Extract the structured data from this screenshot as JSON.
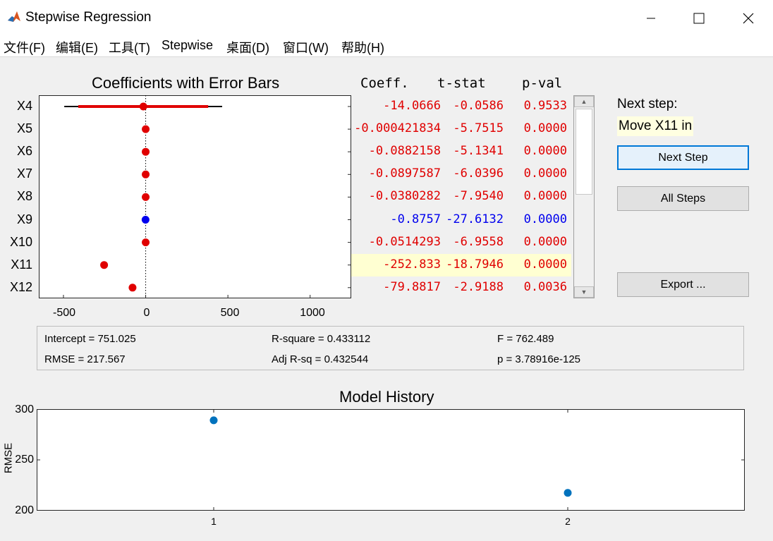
{
  "window": {
    "title": "Stepwise Regression"
  },
  "menu": [
    {
      "label": "文件(F)"
    },
    {
      "label": "编辑(E)"
    },
    {
      "label": "工具(T)"
    },
    {
      "label": "Stepwise"
    },
    {
      "label": "桌面(D)"
    },
    {
      "label": "窗口(W)"
    },
    {
      "label": "帮助(H)"
    }
  ],
  "coef_plot": {
    "title": "Coefficients with Error Bars",
    "x_ticks": [
      "-500",
      "0",
      "500",
      "1000"
    ]
  },
  "table": {
    "headers": {
      "coeff": "Coeff.",
      "tstat": "t-stat",
      "pval": "p-val"
    },
    "rows": [
      {
        "name": "X4",
        "coeff": "-14.0666",
        "tstat": "-0.0586",
        "pval": "0.9533",
        "in_model": true
      },
      {
        "name": "X5",
        "coeff": "-0.000421834",
        "tstat": "-5.7515",
        "pval": "0.0000",
        "in_model": true
      },
      {
        "name": "X6",
        "coeff": "-0.0882158",
        "tstat": "-5.1341",
        "pval": "0.0000",
        "in_model": true
      },
      {
        "name": "X7",
        "coeff": "-0.0897587",
        "tstat": "-6.0396",
        "pval": "0.0000",
        "in_model": true
      },
      {
        "name": "X8",
        "coeff": "-0.0380282",
        "tstat": "-7.9540",
        "pval": "0.0000",
        "in_model": true
      },
      {
        "name": "X9",
        "coeff": "-0.8757",
        "tstat": "-27.6132",
        "pval": "0.0000",
        "in_model": false
      },
      {
        "name": "X10",
        "coeff": "-0.0514293",
        "tstat": "-6.9558",
        "pval": "0.0000",
        "in_model": true
      },
      {
        "name": "X11",
        "coeff": "-252.833",
        "tstat": "-18.7946",
        "pval": "0.0000",
        "in_model": true,
        "highlight": true
      },
      {
        "name": "X12",
        "coeff": "-79.8817",
        "tstat": "-2.9188",
        "pval": "0.0036",
        "in_model": true
      }
    ]
  },
  "side": {
    "next_step_label": "Next step:",
    "next_step_value": "Move X11 in",
    "next_step_button": "Next Step",
    "all_steps_button": "All Steps",
    "export_button": "Export ..."
  },
  "stats": {
    "intercept": "Intercept = 751.025",
    "rmse": "RMSE = 217.567",
    "rsq": "R-square = 0.433112",
    "adjrsq": "Adj R-sq = 0.432544",
    "f": "F = 762.489",
    "p": "p = 3.78916e-125"
  },
  "history": {
    "title": "Model History",
    "ylabel": "RMSE",
    "y_ticks": [
      "300",
      "250",
      "200"
    ],
    "x_ticks": [
      "1",
      "2"
    ]
  },
  "colors": {
    "in_model": "#e00000",
    "out_model": "#0000ee",
    "history_point": "#0072bd",
    "highlight": "#ffffe1"
  },
  "chart_data": [
    {
      "type": "scatter",
      "title": "Coefficients with Error Bars",
      "categories": [
        "X4",
        "X5",
        "X6",
        "X7",
        "X8",
        "X9",
        "X10",
        "X11",
        "X12"
      ],
      "values": [
        -14.0666,
        -0.000421834,
        -0.0882158,
        -0.0897587,
        -0.0380282,
        -0.8757,
        -0.0514293,
        -252.833,
        -79.8817
      ],
      "error_inner": [
        [
          -410,
          380
        ],
        null,
        null,
        null,
        null,
        null,
        null,
        [
          -265,
          -240
        ],
        [
          -95,
          -65
        ]
      ],
      "error_outer": [
        [
          -495,
          465
        ],
        null,
        null,
        null,
        null,
        null,
        null,
        [
          -272,
          -233
        ],
        [
          -102,
          -58
        ]
      ],
      "xlim": [
        -650,
        1250
      ],
      "xlabel": "",
      "ylabel": ""
    },
    {
      "type": "scatter",
      "title": "Model History",
      "x": [
        1,
        2
      ],
      "values": [
        289,
        217.567
      ],
      "xlim": [
        0.5,
        2.5
      ],
      "ylim": [
        200,
        300
      ],
      "xlabel": "",
      "ylabel": "RMSE"
    }
  ]
}
